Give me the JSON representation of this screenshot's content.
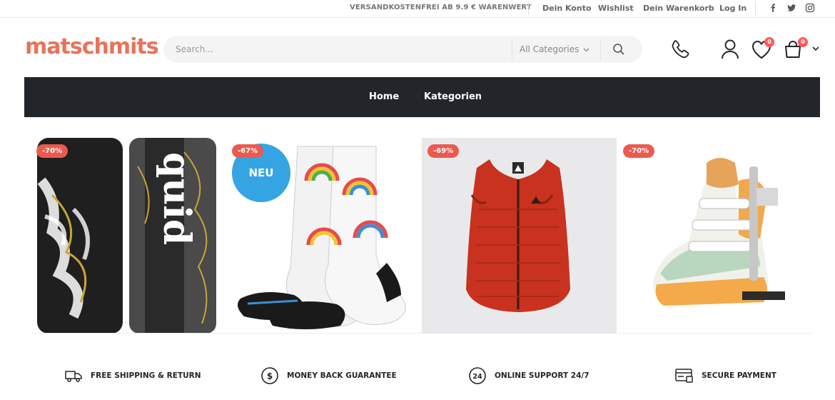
{
  "topbar": {
    "notice": "VERSANDKOSTENFREI AB 9.9 € WARENWERT",
    "links": [
      "Dein Konto",
      "Wishlist",
      "Dein Warenkorb",
      "Log In"
    ],
    "social": [
      "facebook-icon",
      "twitter-icon",
      "instagram-icon"
    ]
  },
  "header": {
    "logo": "matschmits",
    "search": {
      "placeholder": "Search...",
      "category": "All Categories"
    },
    "wishlist_count": "0",
    "cart_count": "0"
  },
  "nav": {
    "items": [
      "Home",
      "Kategorien"
    ]
  },
  "products": [
    {
      "discount": "-70%",
      "image": "wakeboard"
    },
    {
      "discount": "-67%",
      "badge": "NEU",
      "image": "rainbow-socks"
    },
    {
      "discount": "-69%",
      "image": "red-vest"
    },
    {
      "discount": "-70%",
      "image": "wakeboard-binding"
    }
  ],
  "features": [
    {
      "label": "FREE SHIPPING & RETURN",
      "icon": "truck-icon"
    },
    {
      "label": "MONEY BACK GUARANTEE",
      "icon": "dollar-icon"
    },
    {
      "label": "ONLINE SUPPORT 24/7",
      "icon": "support-24-icon"
    },
    {
      "label": "SECURE PAYMENT",
      "icon": "secure-payment-icon"
    }
  ],
  "colors": {
    "brand": "#e8735a",
    "nav_bg": "#222529",
    "discount": "#ec5a4f",
    "neu": "#34a5e2",
    "badge": "#ff5b5b"
  }
}
